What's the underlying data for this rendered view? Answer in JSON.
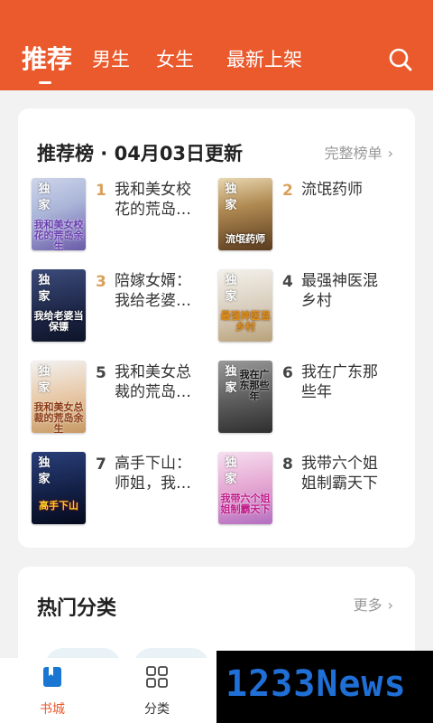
{
  "header": {
    "bg_color": "#ea5a2d",
    "tabs": [
      {
        "label": "推荐",
        "active": true
      },
      {
        "label": "男生",
        "active": false
      },
      {
        "label": "女生",
        "active": false
      },
      {
        "label": "最新上架",
        "active": false
      }
    ],
    "search_icon": "search-icon"
  },
  "ranking": {
    "title": "推荐榜 · 04月03日更新",
    "more_label": "完整榜单",
    "more_arrow": "›",
    "books": [
      {
        "rank": "1",
        "title": "我和美女校花的荒岛…",
        "tag": "独家",
        "cover_title": "我和美女校花的荒岛余生"
      },
      {
        "rank": "2",
        "title": "流氓药师",
        "tag": "独家",
        "cover_title": "流氓药师"
      },
      {
        "rank": "3",
        "title": "陪嫁女婿：我给老婆…",
        "tag": "独家",
        "cover_title": "我给老婆当保镖"
      },
      {
        "rank": "4",
        "title": "最强神医混乡村",
        "tag": "独家",
        "cover_title": "最强神医混乡村"
      },
      {
        "rank": "5",
        "title": "我和美女总裁的荒岛…",
        "tag": "独家",
        "cover_title": "我和美女总裁的荒岛余生"
      },
      {
        "rank": "6",
        "title": "我在广东那些年",
        "tag": "独家",
        "cover_title": "我在广东那些年"
      },
      {
        "rank": "7",
        "title": "高手下山：师姐，我…",
        "tag": "独家",
        "cover_title": "高手下山"
      },
      {
        "rank": "8",
        "title": "我带六个姐姐制霸天下",
        "tag": "独家",
        "cover_title": "我带六个姐姐制霸天下"
      }
    ],
    "rank_colors": [
      "#d9a05b",
      "#d9a05b",
      "#d9a05b",
      "#444444",
      "#444444",
      "#444444",
      "#444444",
      "#444444"
    ]
  },
  "categories": {
    "title": "热门分类",
    "more_label": "更多",
    "more_arrow": "›"
  },
  "bottom_nav": {
    "items": [
      {
        "label": "书城",
        "icon": "bookmark-book-icon",
        "active": true
      },
      {
        "label": "分类",
        "icon": "grid-icon",
        "active": false
      }
    ]
  },
  "watermark": {
    "text": "1233News"
  }
}
